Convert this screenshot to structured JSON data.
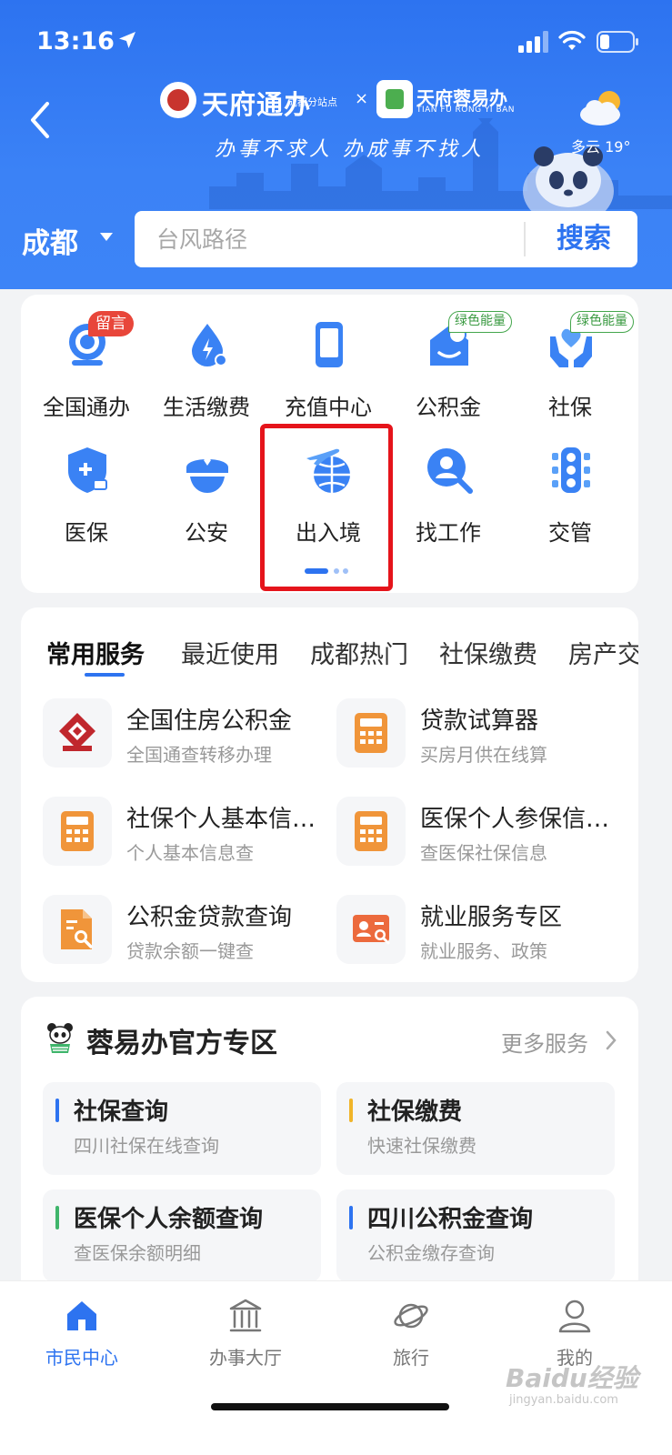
{
  "status_bar": {
    "time": "13:16"
  },
  "header": {
    "brand1_name": "天府通办",
    "brand1_sub": "成都分站点",
    "separator": "×",
    "brand2_name": "天府蓉易办",
    "brand2_sub": "TIAN FU RONG YI BAN",
    "slogan": "办事不求人 办成事不找人",
    "weather": "多云 19°",
    "city": "成都",
    "search_placeholder": "台风路径",
    "search_button": "搜索"
  },
  "grid": {
    "items": [
      {
        "label": "全国通办",
        "icon": "globe-service-icon",
        "badge": "留言"
      },
      {
        "label": "生活缴费",
        "icon": "utility-drop-icon"
      },
      {
        "label": "充值中心",
        "icon": "phone-recharge-icon"
      },
      {
        "label": "公积金",
        "icon": "housing-fund-icon",
        "badge": "绿色能量"
      },
      {
        "label": "社保",
        "icon": "social-security-hands-icon",
        "badge": "绿色能量"
      },
      {
        "label": "医保",
        "icon": "medical-shield-icon"
      },
      {
        "label": "公安",
        "icon": "police-cap-icon"
      },
      {
        "label": "出入境",
        "icon": "airplane-globe-icon"
      },
      {
        "label": "找工作",
        "icon": "job-search-icon"
      },
      {
        "label": "交管",
        "icon": "traffic-light-icon"
      }
    ]
  },
  "services": {
    "tabs": [
      "常用服务",
      "最近使用",
      "成都热门",
      "社保缴费",
      "房产交易"
    ],
    "items": [
      {
        "title": "全国住房公积金",
        "sub": "全国通查转移办理",
        "icon": "housing-fund-logo-icon"
      },
      {
        "title": "贷款试算器",
        "sub": "买房月供在线算",
        "icon": "calculator-icon"
      },
      {
        "title": "社保个人基本信息查询",
        "sub": "个人基本信息查",
        "icon": "calculator-icon"
      },
      {
        "title": "医保个人参保信息查询",
        "sub": "查医保社保信息",
        "icon": "calculator-icon"
      },
      {
        "title": "公积金贷款查询",
        "sub": "贷款余额一键查",
        "icon": "document-search-icon"
      },
      {
        "title": "就业服务专区",
        "sub": "就业服务、政策",
        "icon": "id-card-search-icon"
      }
    ]
  },
  "official": {
    "title": "蓉易办官方专区",
    "more": "更多服务",
    "tiles": [
      {
        "title": "社保查询",
        "sub": "四川社保在线查询",
        "accent": "#2d73f0"
      },
      {
        "title": "社保缴费",
        "sub": "快速社保缴费",
        "accent": "#f0b429"
      },
      {
        "title": "医保个人余额查询",
        "sub": "查医保余额明细",
        "accent": "#3fb56b"
      },
      {
        "title": "四川公积金查询",
        "sub": "公积金缴存查询",
        "accent": "#2d73f0"
      }
    ]
  },
  "tabbar": {
    "items": [
      {
        "label": "市民中心",
        "icon": "home-icon",
        "active": true
      },
      {
        "label": "办事大厅",
        "icon": "government-hall-icon"
      },
      {
        "label": "旅行",
        "icon": "planet-travel-icon"
      },
      {
        "label": "我的",
        "icon": "user-profile-icon"
      }
    ]
  },
  "watermark": {
    "main": "Baidu经验",
    "sub": "jingyan.baidu.com"
  },
  "colors": {
    "primary": "#2d73f0",
    "highlight": "#e5141b",
    "badge_red": "#e8463a",
    "badge_green": "#44a64c",
    "icon_orange": "#f0953a"
  }
}
